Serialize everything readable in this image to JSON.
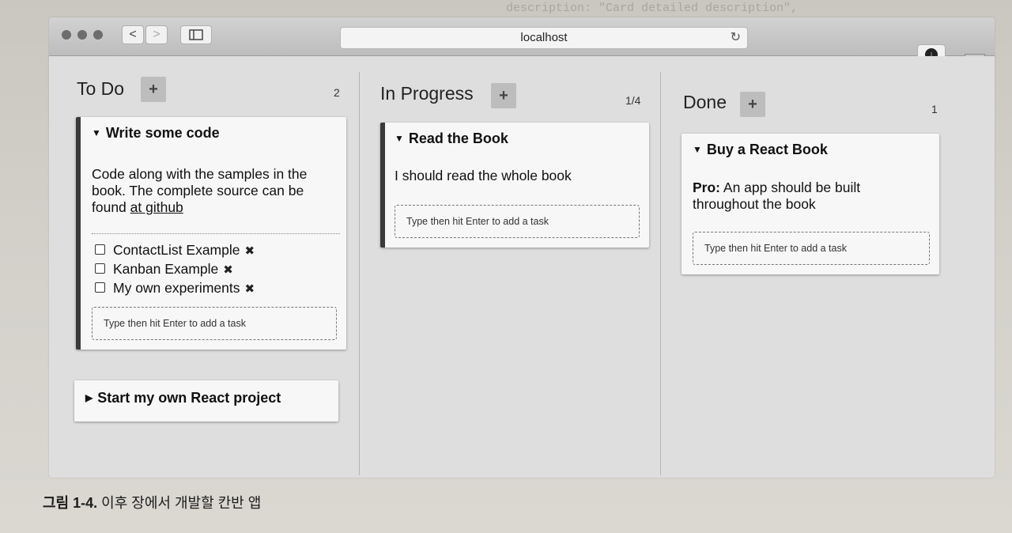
{
  "browser": {
    "url": "localhost",
    "back_label": "<",
    "forward_label": ">",
    "reload_label": "↻",
    "download_label": "↓",
    "new_tab_label": "+"
  },
  "columns": {
    "todo": {
      "title": "To Do",
      "add_label": "+",
      "count": "2",
      "card1": {
        "title": "Write some code",
        "description_text": "Code along with the samples in the book. The complete source can be found ",
        "description_link": "at github",
        "tasks": [
          {
            "name": "ContactList Example",
            "remove": "✖"
          },
          {
            "name": "Kanban Example",
            "remove": "✖"
          },
          {
            "name": "My own experiments",
            "remove": "✖"
          }
        ],
        "add_task_placeholder": "Type then hit Enter to add a task"
      },
      "card2": {
        "title": "Start my own React project"
      }
    },
    "in_progress": {
      "title": "In Progress",
      "add_label": "+",
      "count": "1/4",
      "card1": {
        "title": "Read the Book",
        "description": "I should read the whole book",
        "add_task_placeholder": "Type then hit Enter to add a task"
      }
    },
    "done": {
      "title": "Done",
      "add_label": "+",
      "count": "1",
      "card1": {
        "title": "Buy a React Book",
        "description_bold": "Pro:",
        "description": " An app should be built throughout the book",
        "add_task_placeholder": "Type then hit Enter to add a task"
      }
    }
  },
  "page": {
    "caption_label": "그림 1-4.",
    "caption_text": " 이후 장에서 개발할 칸반 앱",
    "bleed_line": "description: \"Card detailed description\","
  },
  "colors": {
    "accent_border": "#3a3a3a",
    "column_bg": "#dedede",
    "card_bg": "#f7f7f7"
  }
}
